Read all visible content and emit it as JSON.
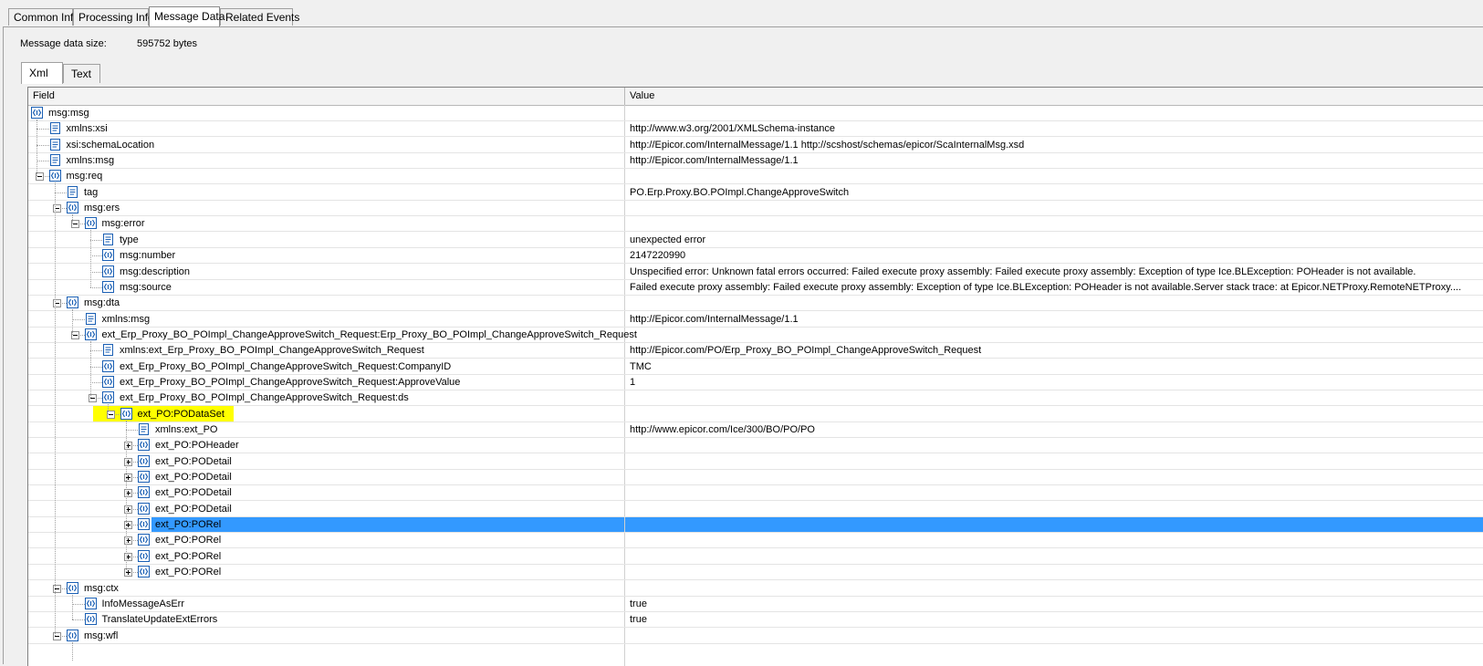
{
  "tabs": [
    "Common Info",
    "Processing Info",
    "Message Data",
    "Related Events"
  ],
  "active_tab": 2,
  "message_size": {
    "label": "Message data size:",
    "value": "595752 bytes"
  },
  "subtabs": [
    "Xml",
    "Text"
  ],
  "columns": {
    "field": "Field",
    "value": "Value"
  },
  "rows": [
    {
      "field": "msg:msg",
      "value": "",
      "depth": 0,
      "icon": "node-icon",
      "toggle": "none"
    },
    {
      "field": "xmlns:xsi",
      "value": "http://www.w3.org/2001/XMLSchema-instance",
      "depth": 1,
      "icon": "attribute-icon",
      "toggle": "none"
    },
    {
      "field": "xsi:schemaLocation",
      "value": "http://Epicor.com/InternalMessage/1.1 http://scshost/schemas/epicor/ScaInternalMsg.xsd",
      "depth": 1,
      "icon": "attribute-icon",
      "toggle": "none"
    },
    {
      "field": "xmlns:msg",
      "value": "http://Epicor.com/InternalMessage/1.1",
      "depth": 1,
      "icon": "attribute-icon",
      "toggle": "none"
    },
    {
      "field": "msg:req",
      "value": "",
      "depth": 1,
      "icon": "node-icon",
      "toggle": "minus"
    },
    {
      "field": "tag",
      "value": "PO.Erp.Proxy.BO.POImpl.ChangeApproveSwitch",
      "depth": 2,
      "icon": "attribute-icon",
      "toggle": "none"
    },
    {
      "field": "msg:ers",
      "value": "",
      "depth": 2,
      "icon": "node-icon",
      "toggle": "minus"
    },
    {
      "field": "msg:error",
      "value": "",
      "depth": 3,
      "icon": "node-icon",
      "toggle": "minus"
    },
    {
      "field": "type",
      "value": "unexpected error",
      "depth": 4,
      "icon": "attribute-icon",
      "toggle": "none"
    },
    {
      "field": "msg:number",
      "value": "2147220990",
      "depth": 4,
      "icon": "node-icon",
      "toggle": "none"
    },
    {
      "field": "msg:description",
      "value": "Unspecified error: Unknown fatal errors occurred: Failed execute proxy assembly: Failed execute proxy assembly:   Exception of type Ice.BLException: POHeader is not available.",
      "depth": 4,
      "icon": "node-icon",
      "toggle": "none"
    },
    {
      "field": "msg:source",
      "value": "Failed execute proxy assembly: Failed execute proxy assembly:   Exception of type Ice.BLException: POHeader is not available.Server stack trace:    at Epicor.NETProxy.RemoteNETProxy....",
      "depth": 4,
      "icon": "node-icon",
      "toggle": "none"
    },
    {
      "field": "msg:dta",
      "value": "",
      "depth": 2,
      "icon": "node-icon",
      "toggle": "minus"
    },
    {
      "field": "xmlns:msg",
      "value": "http://Epicor.com/InternalMessage/1.1",
      "depth": 3,
      "icon": "attribute-icon",
      "toggle": "none"
    },
    {
      "field": "ext_Erp_Proxy_BO_POImpl_ChangeApproveSwitch_Request:Erp_Proxy_BO_POImpl_ChangeApproveSwitch_Request",
      "value": "",
      "depth": 3,
      "icon": "node-icon",
      "toggle": "minus"
    },
    {
      "field": "xmlns:ext_Erp_Proxy_BO_POImpl_ChangeApproveSwitch_Request",
      "value": "http://Epicor.com/PO/Erp_Proxy_BO_POImpl_ChangeApproveSwitch_Request",
      "depth": 4,
      "icon": "attribute-icon",
      "toggle": "none"
    },
    {
      "field": "ext_Erp_Proxy_BO_POImpl_ChangeApproveSwitch_Request:CompanyID",
      "value": "TMC",
      "depth": 4,
      "icon": "node-icon",
      "toggle": "none"
    },
    {
      "field": "ext_Erp_Proxy_BO_POImpl_ChangeApproveSwitch_Request:ApproveValue",
      "value": "1",
      "depth": 4,
      "icon": "node-icon",
      "toggle": "none"
    },
    {
      "field": "ext_Erp_Proxy_BO_POImpl_ChangeApproveSwitch_Request:ds",
      "value": "",
      "depth": 4,
      "icon": "node-icon",
      "toggle": "minus"
    },
    {
      "field": "ext_PO:PODataSet",
      "value": "",
      "depth": 5,
      "icon": "node-icon",
      "toggle": "minus",
      "highlight": true
    },
    {
      "field": "xmlns:ext_PO",
      "value": "http://www.epicor.com/Ice/300/BO/PO/PO",
      "depth": 6,
      "icon": "attribute-icon",
      "toggle": "none"
    },
    {
      "field": "ext_PO:POHeader",
      "value": "",
      "depth": 6,
      "icon": "node-icon",
      "toggle": "plus"
    },
    {
      "field": "ext_PO:PODetail",
      "value": "",
      "depth": 6,
      "icon": "node-icon",
      "toggle": "plus"
    },
    {
      "field": "ext_PO:PODetail",
      "value": "",
      "depth": 6,
      "icon": "node-icon",
      "toggle": "plus"
    },
    {
      "field": "ext_PO:PODetail",
      "value": "",
      "depth": 6,
      "icon": "node-icon",
      "toggle": "plus"
    },
    {
      "field": "ext_PO:PODetail",
      "value": "",
      "depth": 6,
      "icon": "node-icon",
      "toggle": "plus"
    },
    {
      "field": "ext_PO:PORel",
      "value": "",
      "depth": 6,
      "icon": "node-icon",
      "toggle": "plus",
      "selected": true
    },
    {
      "field": "ext_PO:PORel",
      "value": "",
      "depth": 6,
      "icon": "node-icon",
      "toggle": "plus"
    },
    {
      "field": "ext_PO:PORel",
      "value": "",
      "depth": 6,
      "icon": "node-icon",
      "toggle": "plus"
    },
    {
      "field": "ext_PO:PORel",
      "value": "",
      "depth": 6,
      "icon": "node-icon",
      "toggle": "plus"
    },
    {
      "field": "msg:ctx",
      "value": "",
      "depth": 2,
      "icon": "node-icon",
      "toggle": "minus"
    },
    {
      "field": "InfoMessageAsErr",
      "value": "true",
      "depth": 3,
      "icon": "node-icon",
      "toggle": "none"
    },
    {
      "field": "TranslateUpdateExtErrors",
      "value": "true",
      "depth": 3,
      "icon": "node-icon",
      "toggle": "none"
    },
    {
      "field": "msg:wfl",
      "value": "",
      "depth": 2,
      "icon": "node-icon",
      "toggle": "minus"
    }
  ],
  "colors": {
    "selection": "#3399ff",
    "highlight": "#ffff00",
    "icon_blue": "#1a5fb4"
  }
}
